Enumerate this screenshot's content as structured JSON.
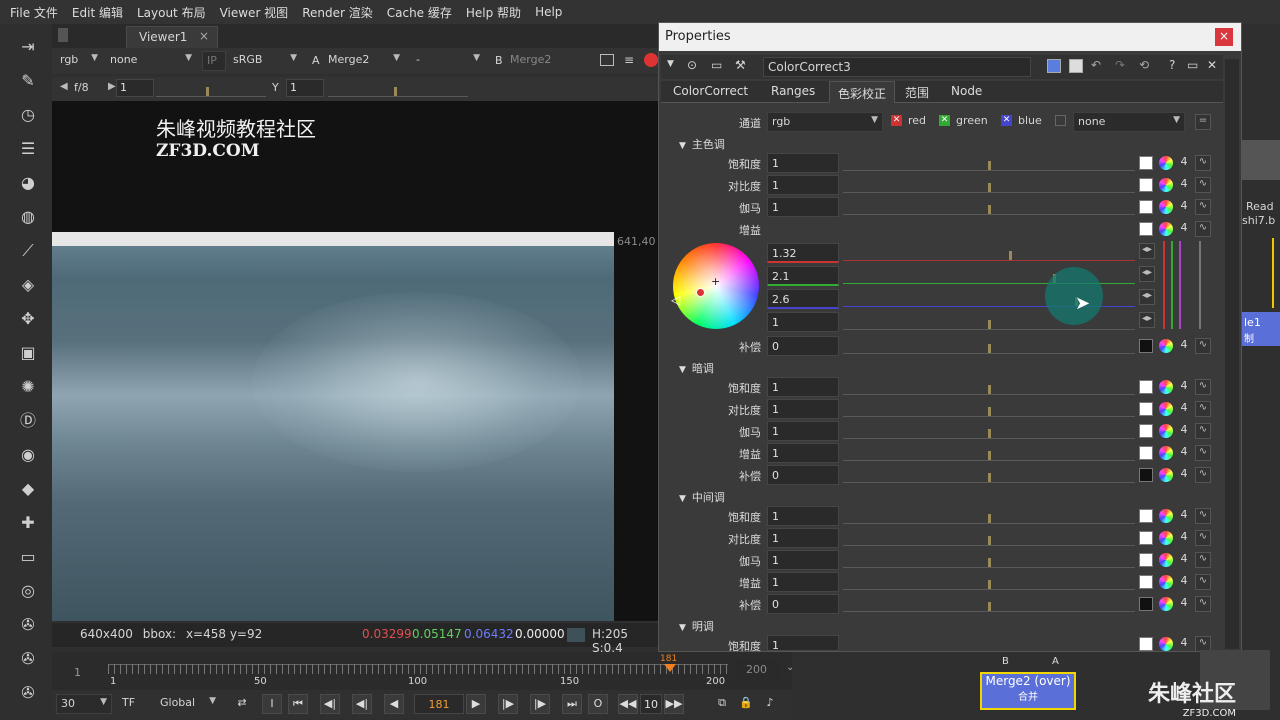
{
  "menu": [
    "File 文件",
    "Edit 编辑",
    "Layout 布局",
    "Viewer 视图",
    "Render 渲染",
    "Cache 缓存",
    "Help 帮助",
    "Help"
  ],
  "viewer": {
    "tab": "Viewer1",
    "tab_close": "×",
    "channel": "rgb",
    "alpha": "none",
    "ip": "IP",
    "lut": "sRGB",
    "a_label": "A",
    "a_input": "Merge2",
    "blend": "-",
    "b_label": "B",
    "b_input": "Merge2",
    "fstop": "f/8",
    "gain": "1",
    "gamma_label": "Y",
    "gamma": "1",
    "watermark_cn": "朱峰视频教程社区",
    "watermark_en": "ZF3D.COM",
    "res_label": "641,40",
    "status_size": "640x400",
    "status_bbox": "bbox:",
    "status_xy": "x=458 y=92",
    "status_r": "0.03299",
    "status_g": "0.05147",
    "status_b": "0.06432",
    "status_a": "0.00000",
    "status_hs": "H:205 S:0.4"
  },
  "timeline": {
    "start": "1",
    "end": "200",
    "current": "181",
    "ticks": [
      "1",
      "50",
      "100",
      "150",
      "200"
    ],
    "fps": "30",
    "tf": "TF",
    "global": "Global",
    "frame_field": "181",
    "step": "10"
  },
  "props": {
    "title": "Properties",
    "close": "×",
    "node_name": "ColorCorrect3",
    "tabs": [
      "ColorCorrect",
      "Ranges",
      "色彩校正",
      "范围",
      "Node"
    ],
    "active_tab": 2,
    "channel_label": "通道",
    "channel_value": "rgb",
    "chan_red": "red",
    "chan_green": "green",
    "chan_blue": "blue",
    "mask": "none",
    "sections": {
      "master": "主色调",
      "shadows": "暗调",
      "midtones": "中间调",
      "highlights": "明调"
    },
    "labels": {
      "sat": "饱和度",
      "contrast": "对比度",
      "gamma": "伽马",
      "gain": "增益",
      "offset": "补偿"
    },
    "master": {
      "sat": "1",
      "contrast": "1",
      "gamma": "1",
      "gain_r": "1.32",
      "gain_g": "2.1",
      "gain_b": "2.6",
      "gain_a": "1",
      "offset": "0"
    },
    "shadows": {
      "sat": "1",
      "contrast": "1",
      "gamma": "1",
      "gain": "1",
      "offset": "0"
    },
    "midtones": {
      "sat": "1",
      "contrast": "1",
      "gamma": "1",
      "gain": "1",
      "offset": "0"
    },
    "highlights": {
      "sat": "1"
    },
    "four": "4"
  },
  "bottom_node": {
    "label": "Merge2 (over)",
    "sub": "合并",
    "b": "B",
    "a": "A"
  },
  "right_nodes": [
    "Read",
    "shi7.b",
    "le1",
    "制"
  ],
  "logo": "朱峰社区",
  "logo_url": "ZF3D.COM"
}
